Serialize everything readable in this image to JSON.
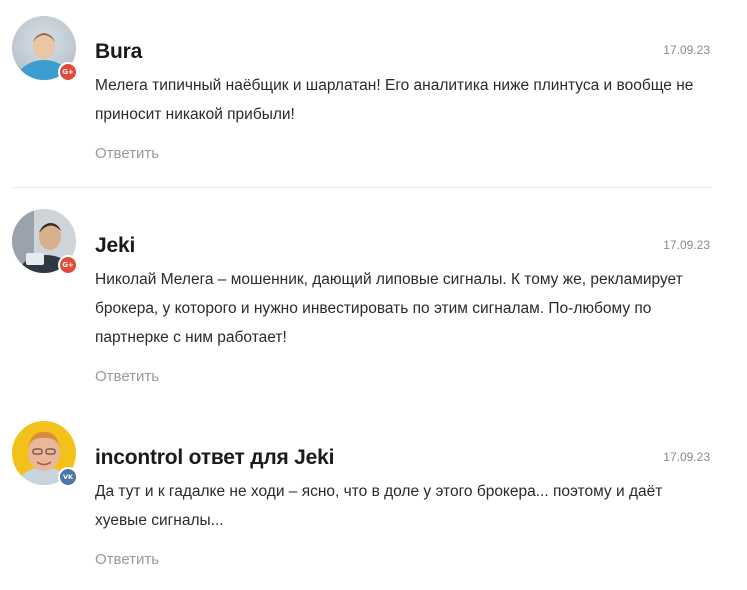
{
  "comments": [
    {
      "author": "Bura",
      "date": "17.09.23",
      "text": "Мелега типичный наёбщик и шарлатан! Его аналитика ниже плинтуса и вообще не приносит никакой прибыли!",
      "reply_label": "Ответить",
      "badge": "G+",
      "badge_color": "#dd4b39"
    },
    {
      "author": "Jeki",
      "date": "17.09.23",
      "text": "Николай Мелега – мошенник, дающий липовые сигналы. К тому же, рекламирует брокера, у которого и нужно инвестировать по этим сигналам. По-любому по партнерке с ним работает!",
      "reply_label": "Ответить",
      "badge": "G+",
      "badge_color": "#dd4b39"
    },
    {
      "author": "incontrol ответ для Jeki",
      "date": "17.09.23",
      "text": "Да тут и к гадалке не ходи – ясно, что в доле у этого брокера... поэтому и даёт хуевые сигналы...",
      "reply_label": "Ответить",
      "badge": "VK",
      "badge_color": "#4a76a8"
    }
  ]
}
